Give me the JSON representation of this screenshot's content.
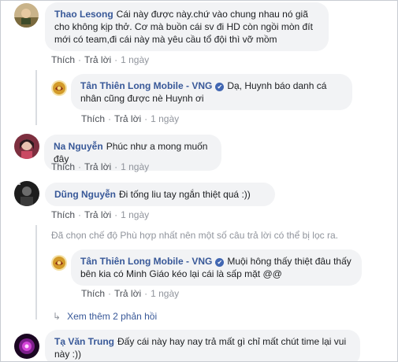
{
  "comments": [
    {
      "author": "Thao Lesong",
      "text": "Cái này được này.chứ vào chung nhau nó giã cho không kịp thở. Cơ mà buồn cái sv đi HD còn ngồi mòn đít mới có team,đi cái này mà yêu cầu tổ đội thì vỡ mồm",
      "like": "Thích",
      "reply": "Trả lời",
      "time": "1 ngày"
    },
    {
      "author": "Tân Thiên Long Mobile - VNG",
      "verified": "✔",
      "text": "Dạ, Huynh báo danh cá nhân cũng được nè Huynh ơi",
      "like": "Thích",
      "reply": "Trả lời",
      "time": "1 ngày"
    },
    {
      "author": "Na Nguyễn",
      "text": "Phúc như a mong muốn đây",
      "like": "Thích",
      "reply": "Trả lời",
      "time": "1 ngày"
    },
    {
      "author": "Dũng Nguyễn",
      "text": "Đi tống liu tay ngắn thiệt quá :))",
      "like": "Thích",
      "reply": "Trả lời",
      "time": "1 ngày"
    },
    {
      "author": "Tân Thiên Long Mobile - VNG",
      "verified": "✔",
      "text": "Muội hông thấy thiệt đâu thấy bên kia có Minh Giáo kéo lại cái là sấp mặt @@",
      "like": "Thích",
      "reply": "Trả lời",
      "time": "1 ngày"
    },
    {
      "author": "Tạ Văn Trung",
      "text": "Đấy cái này hay nay trả mất gì chỉ mất chút time lại vui này :))"
    }
  ],
  "filter_notice": "Đã chọn chế độ Phù hợp nhất nên một số câu trả lời có thể bị lọc ra.",
  "more_replies": {
    "arrow": "↳",
    "label": "Xem thêm 2 phản hồi"
  },
  "colors": {
    "name_link": "#385898",
    "bubble_bg": "#f2f3f5",
    "verified_badge": "#4267b2",
    "meta_text": "#90949c"
  }
}
